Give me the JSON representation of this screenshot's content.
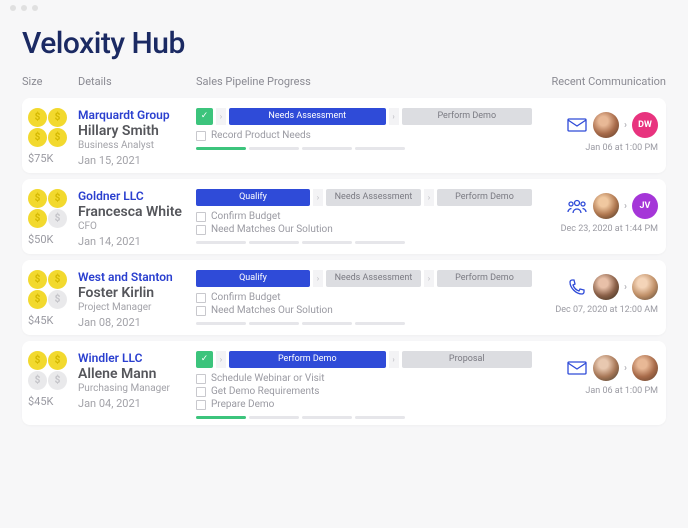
{
  "title": "Veloxity Hub",
  "headers": {
    "size": "Size",
    "details": "Details",
    "pipeline": "Sales Pipeline Progress",
    "comm": "Recent Communication"
  },
  "rows": [
    {
      "coins": [
        "gold",
        "gold",
        "gold",
        "gold"
      ],
      "amount": "$75K",
      "company": "Marquardt Group",
      "person": "Hillary Smith",
      "role": "Business Analyst",
      "date": "Jan 15, 2021",
      "stages": [
        {
          "type": "done",
          "label": "✓"
        },
        {
          "type": "active",
          "label": "Needs Assessment"
        },
        {
          "type": "next",
          "label": "Perform Demo"
        }
      ],
      "tasks": [
        "Record Product Needs"
      ],
      "progress": [
        "green",
        "gray",
        "gray",
        "gray"
      ],
      "comm": {
        "icon": "mail",
        "from": {
          "kind": "photo",
          "cls": "photo1"
        },
        "to": {
          "kind": "badge",
          "text": "DW",
          "cls": "badge-pink"
        },
        "date": "Jan 06 at 1:00 PM"
      }
    },
    {
      "coins": [
        "gold",
        "gold",
        "gold",
        "gray"
      ],
      "amount": "$50K",
      "company": "Goldner LLC",
      "person": "Francesca White",
      "role": "CFO",
      "date": "Jan 14, 2021",
      "stages": [
        {
          "type": "active",
          "label": "Qualify"
        },
        {
          "type": "next",
          "label": "Needs Assessment"
        },
        {
          "type": "next",
          "label": "Perform Demo"
        }
      ],
      "tasks": [
        "Confirm Budget",
        "Need Matches Our Solution"
      ],
      "progress": [
        "gray",
        "gray",
        "gray",
        "gray"
      ],
      "comm": {
        "icon": "people",
        "from": {
          "kind": "photo",
          "cls": "photo2"
        },
        "to": {
          "kind": "badge",
          "text": "JV",
          "cls": "badge-purple"
        },
        "date": "Dec 23, 2020 at 1:44 PM"
      }
    },
    {
      "coins": [
        "gold",
        "gold",
        "gold",
        "gray"
      ],
      "amount": "$45K",
      "company": "West and Stanton",
      "person": "Foster Kirlin",
      "role": "Project Manager",
      "date": "Jan 08, 2021",
      "stages": [
        {
          "type": "active",
          "label": "Qualify"
        },
        {
          "type": "next",
          "label": "Needs Assessment"
        },
        {
          "type": "next",
          "label": "Perform Demo"
        }
      ],
      "tasks": [
        "Confirm Budget",
        "Need Matches Our Solution"
      ],
      "progress": [
        "gray",
        "gray",
        "gray",
        "gray"
      ],
      "comm": {
        "icon": "phone",
        "from": {
          "kind": "photo",
          "cls": "photo3"
        },
        "to": {
          "kind": "photo",
          "cls": "photo4"
        },
        "date": "Dec 07, 2020 at 12:00 AM"
      }
    },
    {
      "coins": [
        "gold",
        "gold",
        "gray",
        "gray"
      ],
      "amount": "$45K",
      "company": "Windler LLC",
      "person": "Allene Mann",
      "role": "Purchasing Manager",
      "date": "Jan 04, 2021",
      "stages": [
        {
          "type": "done",
          "label": "✓"
        },
        {
          "type": "active",
          "label": "Perform Demo"
        },
        {
          "type": "next",
          "label": "Proposal"
        }
      ],
      "tasks": [
        "Schedule Webinar or Visit",
        "Get Demo Requirements",
        "Prepare Demo"
      ],
      "progress": [
        "green",
        "gray",
        "gray",
        "gray"
      ],
      "comm": {
        "icon": "mail",
        "from": {
          "kind": "photo",
          "cls": "photo5"
        },
        "to": {
          "kind": "photo",
          "cls": "photo1"
        },
        "date": "Jan 06 at 1:00 PM"
      }
    }
  ],
  "icons": {
    "mail": "✉",
    "people": "⚘",
    "phone": "✆"
  }
}
